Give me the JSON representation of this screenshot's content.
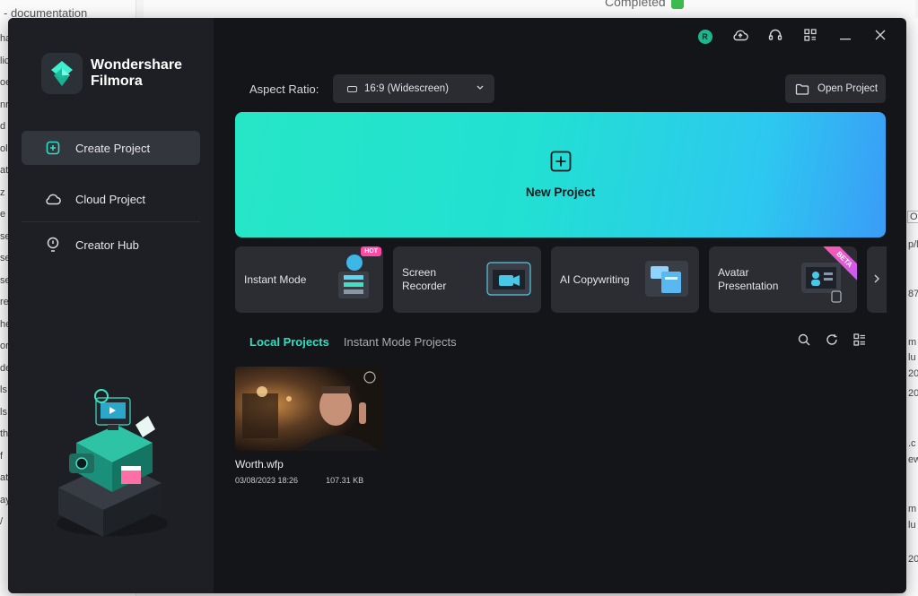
{
  "background": {
    "left_doc_title": "- documentation",
    "left_fragments": [
      "ha",
      "lic",
      "oe",
      "nr",
      "d c",
      "ol",
      "at",
      "z",
      "e",
      "se",
      "se",
      "se",
      "re",
      "he",
      "or",
      "de",
      "ls",
      "ls",
      "th",
      "f",
      "at",
      "ay",
      "/"
    ],
    "top_status": "Completed",
    "right_fragments": [
      "O",
      "p/l",
      "87",
      "m",
      "lu",
      "20",
      "20",
      ".c",
      "ew",
      "m",
      "lu",
      "20"
    ]
  },
  "app": {
    "brand_line1": "Wondershare",
    "brand_line2": "Filmora",
    "user_initial": "R"
  },
  "sidebar": {
    "items": [
      {
        "label": "Create Project",
        "icon": "plus-square-icon",
        "active": true
      },
      {
        "label": "Cloud Project",
        "icon": "cloud-icon",
        "active": false
      },
      {
        "label": "Creator Hub",
        "icon": "bulb-icon",
        "active": false
      }
    ]
  },
  "toolbar": {
    "aspect_label": "Aspect Ratio:",
    "aspect_value": "16:9 (Widescreen)",
    "open_project": "Open Project"
  },
  "new_project": {
    "label": "New Project"
  },
  "quick_actions": [
    {
      "label": "Instant Mode",
      "badge": "HOT"
    },
    {
      "label": "Screen Recorder",
      "badge": ""
    },
    {
      "label": "AI Copywriting",
      "badge": ""
    },
    {
      "label": "Avatar Presentation",
      "badge": "BETA"
    }
  ],
  "project_tabs": {
    "local": "Local Projects",
    "instant": "Instant Mode Projects"
  },
  "projects": [
    {
      "name": "Worth.wfp",
      "date": "03/08/2023 18:26",
      "size": "107.31 KB"
    }
  ],
  "colors": {
    "accent": "#2de0c4",
    "window_bg": "#141519",
    "sidebar_bg": "#1d1f24"
  }
}
